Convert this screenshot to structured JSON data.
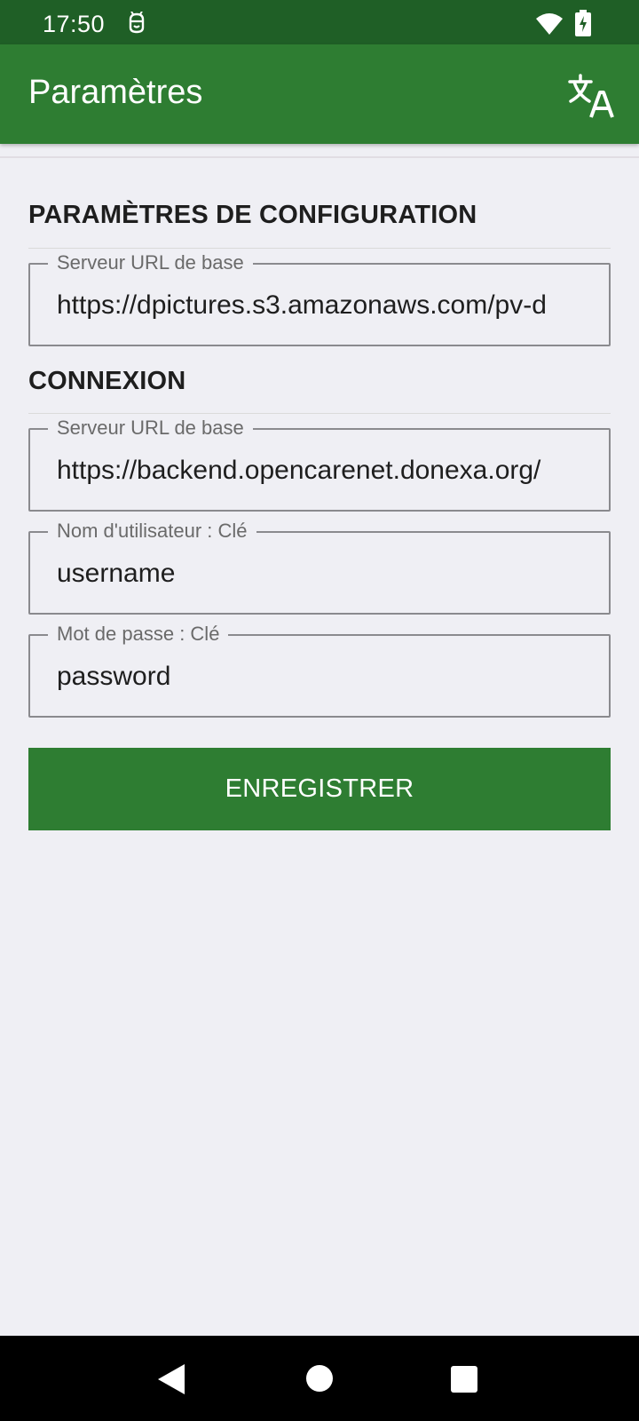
{
  "status_bar": {
    "time": "17:50",
    "icons": [
      "notification-icon",
      "wifi-icon",
      "battery-charging-icon"
    ]
  },
  "app_bar": {
    "title": "Paramètres",
    "action_icon": "translate-icon",
    "background": "#2e7d32",
    "status_background": "#1f5f26"
  },
  "sections": {
    "configuration": {
      "title": "PARAMÈTRES DE CONFIGURATION",
      "base_url_label": "Serveur URL de base",
      "base_url_value": "https://dpictures.s3.amazonaws.com/pv-d"
    },
    "connexion": {
      "title": "CONNEXION",
      "base_url_label": "Serveur URL de base",
      "base_url_value": "https://backend.opencarenet.donexa.org/",
      "username_label": "Nom d'utilisateur : Clé",
      "username_value": "username",
      "password_label": "Mot de passe : Clé",
      "password_value": "password"
    }
  },
  "save_button": {
    "label": "ENREGISTRER"
  },
  "nav_bar": {
    "icons": [
      "back-icon",
      "home-icon",
      "recents-icon"
    ]
  }
}
